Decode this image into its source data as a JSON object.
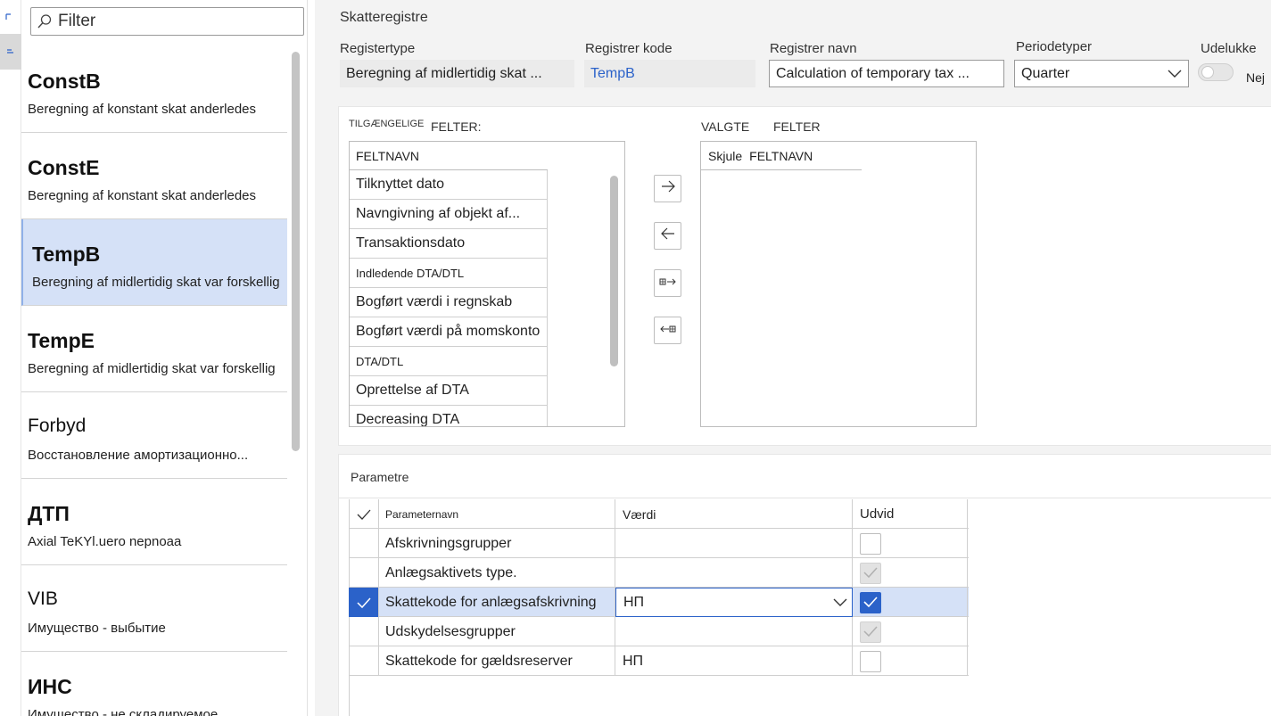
{
  "sidebar": {
    "filter": {
      "placeholder": "Filter"
    },
    "items": [
      {
        "code": "ConstB",
        "desc": "Beregning af konstant skat anderledes"
      },
      {
        "code": "ConstE",
        "desc": "Beregning af konstant skat anderledes"
      },
      {
        "code": "TempB",
        "desc": "Beregning af midlertidig skat var forskellig"
      },
      {
        "code": "TempE",
        "desc": "Beregning af midlertidig skat var forskellig"
      },
      {
        "code": "Forbyd",
        "desc": "Восстановление амортизационно..."
      },
      {
        "code": "ДТП",
        "desc": "Axial TeKYl.uero nepnoaa"
      },
      {
        "code": "VIB",
        "desc": "Имущество - выбытие"
      },
      {
        "code": "ИНС",
        "desc": "Имущество - не складируемое"
      }
    ]
  },
  "header": {
    "title": "Skatteregistre",
    "register_type": {
      "label": "Registertype",
      "value": "Beregning af midlertidig skat ..."
    },
    "register_code": {
      "label": "Registrer kode",
      "value": "TempB"
    },
    "register_name": {
      "label": "Registrer navn",
      "value": "Calculation of temporary tax ..."
    },
    "period_type": {
      "label": "Periodetyper",
      "value": "Quarter"
    },
    "exclude": {
      "label": "Udelukke",
      "value": "Nej"
    }
  },
  "fields": {
    "available_caption_a": "TILGÆNGELIGE",
    "available_caption_b": "FELTER:",
    "available_column": "FELTNAVN",
    "available_items": [
      "Tilknyttet dato",
      "Navngivning af objekt af...",
      "Transaktionsdato",
      "Indledende DTA/DTL",
      "Bogført værdi i regnskab",
      "Bogført værdi på momskonto",
      "DTA/DTL",
      "Oprettelse af DTA",
      "Decreasing DTA"
    ],
    "selected_caption_a": "VALGTE",
    "selected_caption_b": "FELTER",
    "selected_col_hide": "Skjule",
    "selected_col_name": "FELTNAVN"
  },
  "parameters": {
    "title": "Parametre",
    "columns": {
      "name": "Parameternavn",
      "value": "Værdi",
      "expand": "Udvid"
    },
    "rows": [
      {
        "name": "Afskrivningsgrupper",
        "value": "",
        "expand": "empty"
      },
      {
        "name": "Anlægsaktivets type.",
        "value": "",
        "expand": "disabled-checked"
      },
      {
        "name": "Skattekode for anlægsafskrivning",
        "value": "НП",
        "expand": "checked"
      },
      {
        "name": "Udskydelsesgrupper",
        "value": "",
        "expand": "disabled-checked"
      },
      {
        "name": "Skattekode for gældsreserver",
        "value": "НП",
        "expand": "empty"
      }
    ]
  },
  "colors": {
    "accent": "#2b62c9",
    "selection": "#d5e1f7"
  }
}
